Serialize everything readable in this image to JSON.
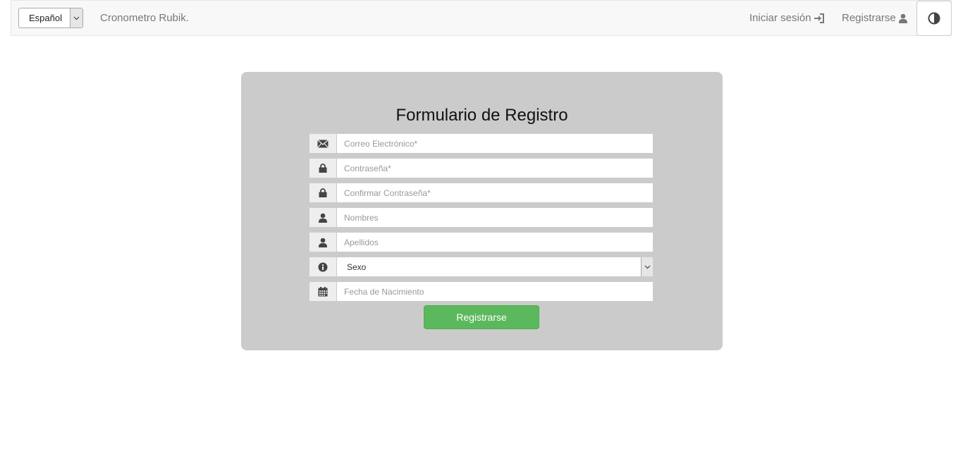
{
  "navbar": {
    "language": "Español",
    "brand": "Cronometro Rubik.",
    "login_label": "Iniciar sesión",
    "login_icon": "log-in-icon",
    "register_label": "Registrarse",
    "register_icon": "user-icon",
    "contrast_icon": "contrast-icon"
  },
  "form": {
    "title": "Formulario de Registro",
    "fields": [
      {
        "icon": "envelope-icon",
        "placeholder": "Correo Electrónico*"
      },
      {
        "icon": "lock-icon",
        "placeholder": "Contraseña*"
      },
      {
        "icon": "lock-icon",
        "placeholder": "Confirmar Contraseña*"
      },
      {
        "icon": "user-icon",
        "placeholder": "Nombres"
      },
      {
        "icon": "user-icon",
        "placeholder": "Apellidos"
      },
      {
        "icon": "info-icon",
        "selected": "Sexo"
      },
      {
        "icon": "calendar-icon",
        "placeholder": "Fecha de Nacimiento"
      }
    ],
    "submit_label": "Registrarse"
  },
  "colors": {
    "panel": "#cbcbcb",
    "submit": "#5cb85c",
    "navbar": "#f8f8f8"
  }
}
